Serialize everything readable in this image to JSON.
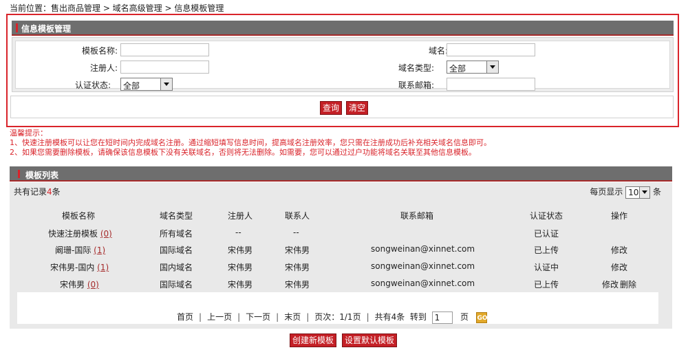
{
  "breadcrumb": "当前位置：售出商品管理 > 域名高级管理 > 信息模板管理",
  "search_panel": {
    "title": "信息模板管理",
    "fields": {
      "template_name_label": "模板名称:",
      "domain_label": "域名:",
      "registrant_label": "注册人:",
      "domain_type_label": "域名类型:",
      "domain_type_value": "全部",
      "auth_status_label": "认证状态:",
      "auth_status_value": "全部",
      "contact_email_label": "联系邮箱:"
    },
    "query_button": "查询",
    "clear_button": "清空"
  },
  "tips": {
    "title": "温馨提示：",
    "line1": "1、快速注册模板可以让您在短时间内完成域名注册。通过缩短填写信息时间，提高域名注册效率，您只需在注册成功后补充相关域名信息即可。",
    "line2": "2、如果您需要删除模板，请确保该信息模板下没有关联域名，否则将无法删除。如需要，您可以通过过户功能将域名关联至其他信息模板。"
  },
  "list_panel": {
    "title": "模板列表",
    "total_prefix": "共有记录",
    "total_count": "4",
    "total_suffix": "条",
    "per_page_label": "每页显示",
    "per_page_value": "10",
    "per_page_unit": "条",
    "columns": [
      "模板名称",
      "域名类型",
      "注册人",
      "联系人",
      "联系邮箱",
      "认证状态",
      "操作"
    ],
    "rows": [
      {
        "name": "快速注册模板",
        "count": "(0)",
        "type": "所有域名",
        "registrant": "--",
        "contact": "--",
        "email": "",
        "status": "已认证",
        "edit": "",
        "delete": ""
      },
      {
        "name": "阚珊-国际",
        "count": "(1)",
        "type": "国际域名",
        "registrant": "宋伟男",
        "contact": "宋伟男",
        "email": "songweinan@xinnet.com",
        "status": "已上传",
        "edit": "修改",
        "delete": ""
      },
      {
        "name": "宋伟男-国内",
        "count": "(1)",
        "type": "国内域名",
        "registrant": "宋伟男",
        "contact": "宋伟男",
        "email": "songweinan@xinnet.com",
        "status": "认证中",
        "edit": "修改",
        "delete": ""
      },
      {
        "name": "宋伟男",
        "count": "(0)",
        "type": "国际域名",
        "registrant": "宋伟男",
        "contact": "宋伟男",
        "email": "songweinan@xinnet.com",
        "status": "已上传",
        "edit": "修改",
        "delete": "删除"
      }
    ],
    "pager": {
      "first": "首页",
      "prev": "上一页",
      "next": "下一页",
      "last": "末页",
      "page_info": "页次：1/1页",
      "total_info": "共有4条",
      "goto_label": "转到",
      "goto_value": "1",
      "page_unit": "页",
      "go_button": "GO"
    }
  },
  "create_button": "创建新模板",
  "default_button": "设置默认模板",
  "colors": {
    "accent_red": "#d9232a",
    "bar_gray": "#6e6e6e",
    "button_red": "#c42026"
  }
}
